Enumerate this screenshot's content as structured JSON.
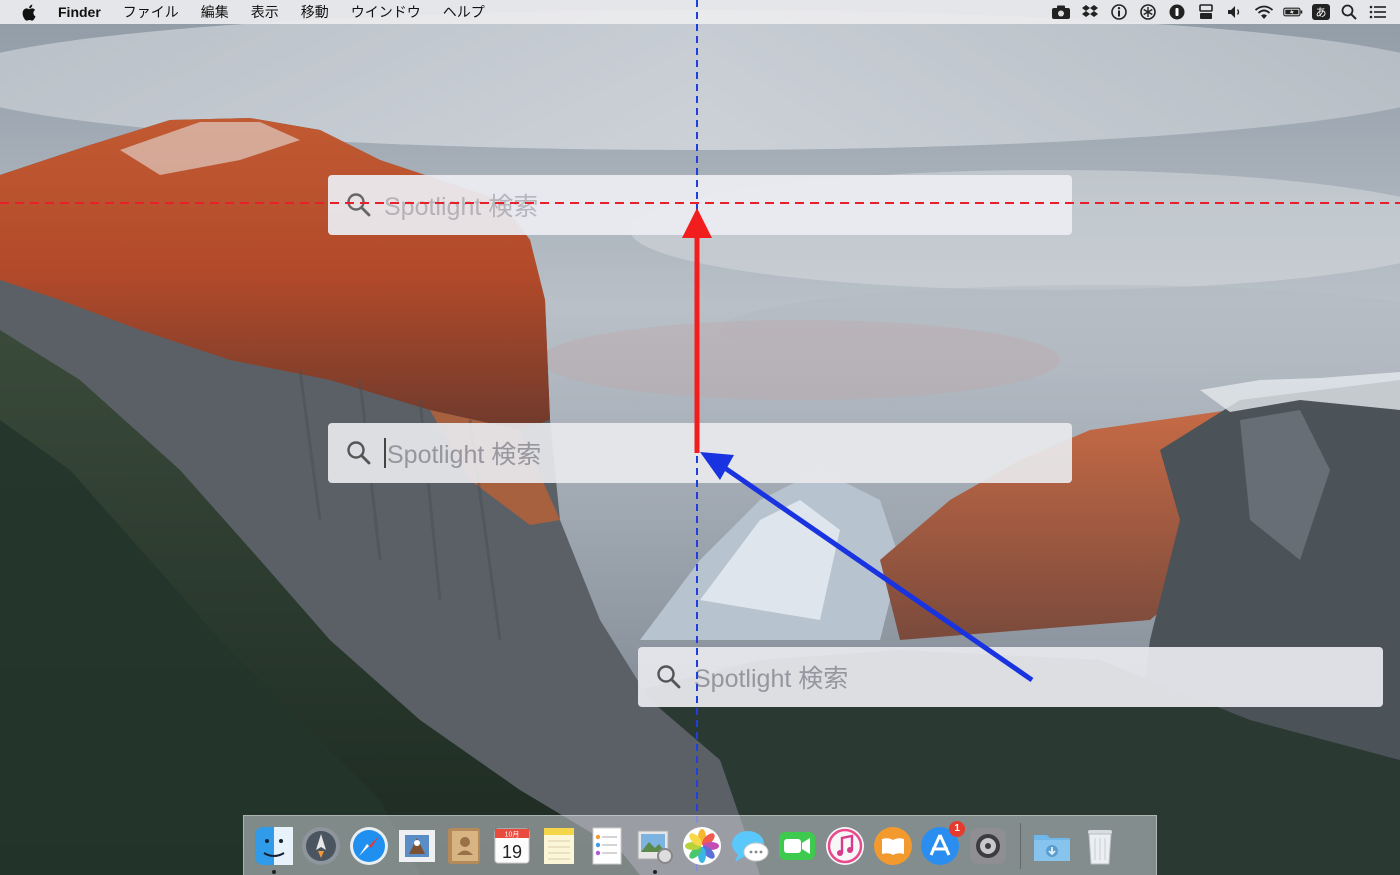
{
  "menubar": {
    "app_name": "Finder",
    "menus": [
      "ファイル",
      "編集",
      "表示",
      "移動",
      "ウインドウ",
      "ヘルプ"
    ],
    "status_icons": [
      "camera-icon",
      "dropbox-icon",
      "info-icon",
      "snowflake-icon",
      "1password-icon",
      "toggle-icon",
      "volume-icon",
      "wifi-icon",
      "battery-icon",
      "input-method-icon",
      "search-icon",
      "list-icon"
    ],
    "input_method_label": "あ"
  },
  "spotlight": {
    "placeholder": "Spotlight 検索"
  },
  "dock": {
    "items": [
      {
        "name": "finder",
        "running": true
      },
      {
        "name": "launchpad",
        "running": false
      },
      {
        "name": "safari",
        "running": false
      },
      {
        "name": "mail",
        "running": false
      },
      {
        "name": "contacts",
        "running": false
      },
      {
        "name": "calendar",
        "running": false,
        "month": "10月",
        "day": "19"
      },
      {
        "name": "notes",
        "running": false
      },
      {
        "name": "reminders",
        "running": false
      },
      {
        "name": "preview",
        "running": true
      },
      {
        "name": "photos",
        "running": false
      },
      {
        "name": "messages",
        "running": false
      },
      {
        "name": "facetime",
        "running": false
      },
      {
        "name": "itunes",
        "running": false
      },
      {
        "name": "ibooks",
        "running": false
      },
      {
        "name": "app-store",
        "running": false,
        "badge": "1"
      },
      {
        "name": "system-preferences",
        "running": false
      },
      {
        "name": "downloads",
        "running": false
      },
      {
        "name": "trash",
        "running": false
      }
    ]
  },
  "colors": {
    "guide_red": "#e8202a",
    "guide_blue": "#1f3fe0",
    "arrow_red": "#f21d1d",
    "arrow_blue": "#1a33e0"
  }
}
